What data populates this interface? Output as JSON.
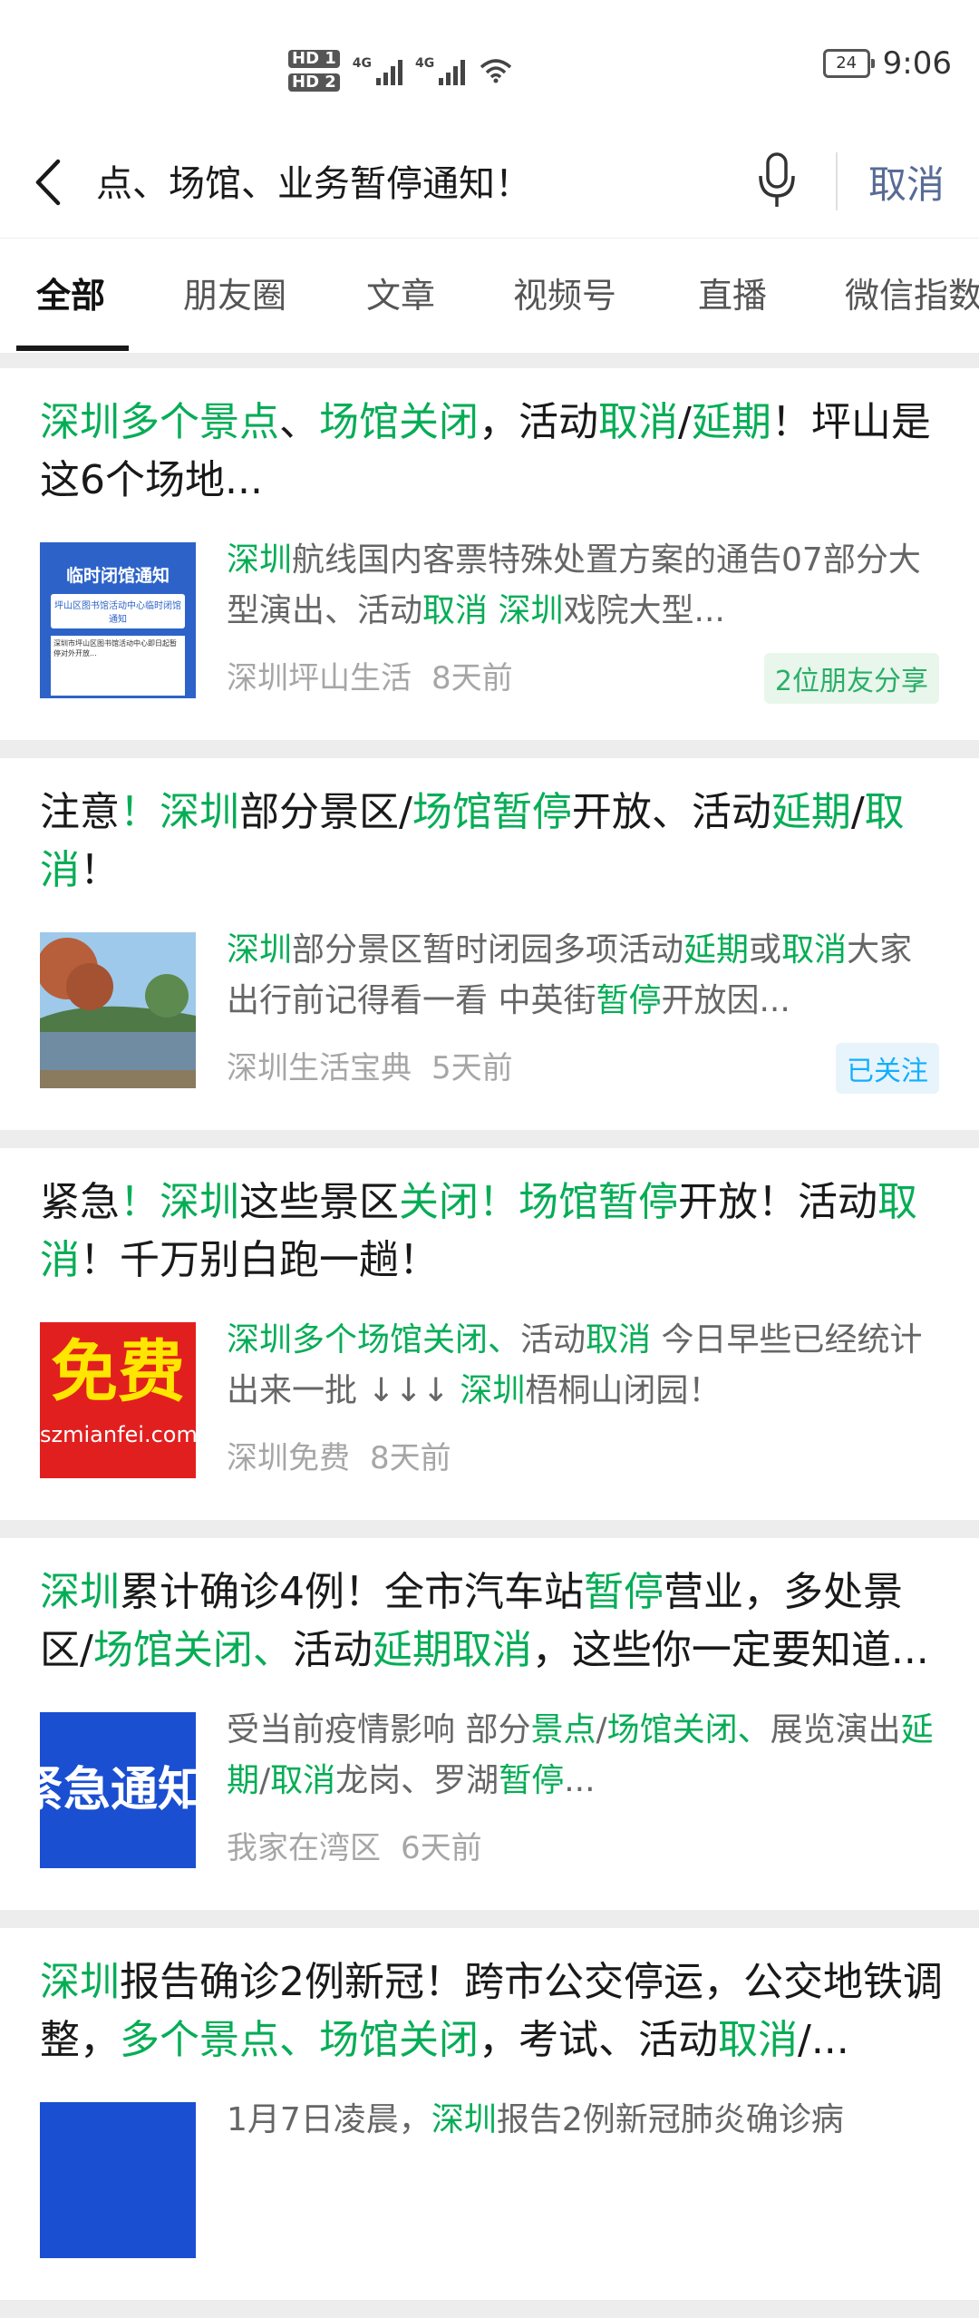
{
  "status_bar": {
    "hd1": "HD 1",
    "hd2": "HD 2",
    "net1": "4G",
    "net2": "4G",
    "battery": "24",
    "time": "9:06"
  },
  "search": {
    "query": "点、场馆、业务暂停通知！",
    "cancel_label": "取消"
  },
  "tabs": [
    "全部",
    "朋友圈",
    "文章",
    "视频号",
    "直播",
    "微信指数"
  ],
  "results": [
    {
      "title": [
        {
          "t": "深圳多个景点",
          "h": true
        },
        {
          "t": "、",
          "h": false
        },
        {
          "t": "场馆关闭",
          "h": true
        },
        {
          "t": "，活动",
          "h": false
        },
        {
          "t": "取消",
          "h": true
        },
        {
          "t": "/",
          "h": false
        },
        {
          "t": "延期",
          "h": true
        },
        {
          "t": "！坪山是这6个场地...",
          "h": false
        }
      ],
      "desc": [
        {
          "t": "深圳",
          "h": true
        },
        {
          "t": "航线国内客票特殊处置方案的通告07部分大型演出、活动",
          "h": false
        },
        {
          "t": "取消",
          "h": true
        },
        {
          "t": " ",
          "h": false
        },
        {
          "t": "深圳",
          "h": true
        },
        {
          "t": "戏院大型...",
          "h": false
        }
      ],
      "source": "深圳坪山生活",
      "time": "8天前",
      "badge": "2位朋友分享",
      "badge_type": "green",
      "thumb": {
        "type": "notice",
        "title": "临时闭馆通知",
        "line": "坪山区图书馆活动中心临时闭馆通知",
        "body": "深圳市坪山区图书馆活动中心即日起暂停对外开放..."
      }
    },
    {
      "title": [
        {
          "t": "注意",
          "h": false
        },
        {
          "t": "！",
          "h": true
        },
        {
          "t": "深圳",
          "h": true
        },
        {
          "t": "部分景区/",
          "h": false
        },
        {
          "t": "场馆暂停",
          "h": true
        },
        {
          "t": "开放、活动",
          "h": false
        },
        {
          "t": "延期",
          "h": true
        },
        {
          "t": "/",
          "h": false
        },
        {
          "t": "取消",
          "h": true
        },
        {
          "t": "！",
          "h": false
        }
      ],
      "desc": [
        {
          "t": "深圳",
          "h": true
        },
        {
          "t": "部分景区暂时闭园多项活动",
          "h": false
        },
        {
          "t": "延期",
          "h": true
        },
        {
          "t": "或",
          "h": false
        },
        {
          "t": "取消",
          "h": true
        },
        {
          "t": "大家出行前记得看一看 中英街",
          "h": false
        },
        {
          "t": "暂停",
          "h": true
        },
        {
          "t": "开放因...",
          "h": false
        }
      ],
      "source": "深圳生活宝典",
      "time": "5天前",
      "badge": "已关注",
      "badge_type": "blue",
      "thumb": {
        "type": "lake"
      }
    },
    {
      "title": [
        {
          "t": "紧急",
          "h": false
        },
        {
          "t": "！",
          "h": true
        },
        {
          "t": "深圳",
          "h": true
        },
        {
          "t": "这些景区",
          "h": false
        },
        {
          "t": "关闭！",
          "h": true
        },
        {
          "t": "场馆暂停",
          "h": true
        },
        {
          "t": "开放！活动",
          "h": false
        },
        {
          "t": "取消",
          "h": true
        },
        {
          "t": "！千万别白跑一趟！",
          "h": false
        }
      ],
      "desc": [
        {
          "t": "深圳多个场馆关闭、",
          "h": true
        },
        {
          "t": "活动",
          "h": false
        },
        {
          "t": "取消",
          "h": true
        },
        {
          "t": " 今日早些已经统计出来一批 ↓↓↓ ",
          "h": false
        },
        {
          "t": "深圳",
          "h": true
        },
        {
          "t": "梧桐山闭园！",
          "h": false
        }
      ],
      "source": "深圳免费",
      "time": "8天前",
      "badge": "",
      "badge_type": "",
      "thumb": {
        "type": "free",
        "big": "免费",
        "small": "szmianfei.com"
      }
    },
    {
      "title": [
        {
          "t": "深圳",
          "h": true
        },
        {
          "t": "累计确诊4例！全市汽车站",
          "h": false
        },
        {
          "t": "暂停",
          "h": true
        },
        {
          "t": "营业，多处景区/",
          "h": false
        },
        {
          "t": "场馆关闭、",
          "h": true
        },
        {
          "t": "活动",
          "h": false
        },
        {
          "t": "延期取消",
          "h": true
        },
        {
          "t": "，这些你一定要知道...",
          "h": false
        }
      ],
      "desc": [
        {
          "t": "受当前疫情影响 部分",
          "h": false
        },
        {
          "t": "景点",
          "h": true
        },
        {
          "t": "/",
          "h": false
        },
        {
          "t": "场馆关闭、",
          "h": true
        },
        {
          "t": "展览演出",
          "h": false
        },
        {
          "t": "延期",
          "h": true
        },
        {
          "t": "/",
          "h": false
        },
        {
          "t": "取消",
          "h": true
        },
        {
          "t": "龙岗、罗湖",
          "h": false
        },
        {
          "t": "暂停",
          "h": true
        },
        {
          "t": "...",
          "h": false
        }
      ],
      "source": "我家在湾区",
      "time": "6天前",
      "badge": "",
      "badge_type": "",
      "thumb": {
        "type": "urgent",
        "text": "紧急通知"
      }
    },
    {
      "title": [
        {
          "t": "深圳",
          "h": true
        },
        {
          "t": "报告确诊2例新冠！跨市公交停运，公交地铁调整，",
          "h": false
        },
        {
          "t": "多个景点、场馆关闭",
          "h": true
        },
        {
          "t": "，考试、活动",
          "h": false
        },
        {
          "t": "取消",
          "h": true
        },
        {
          "t": "/...",
          "h": false
        }
      ],
      "desc": [
        {
          "t": "1月7日凌晨，",
          "h": false
        },
        {
          "t": "深圳",
          "h": true
        },
        {
          "t": "报告2例新冠肺炎确诊病",
          "h": false
        }
      ],
      "source": "",
      "time": "",
      "badge": "",
      "badge_type": "",
      "thumb": {
        "type": "blue"
      }
    }
  ]
}
